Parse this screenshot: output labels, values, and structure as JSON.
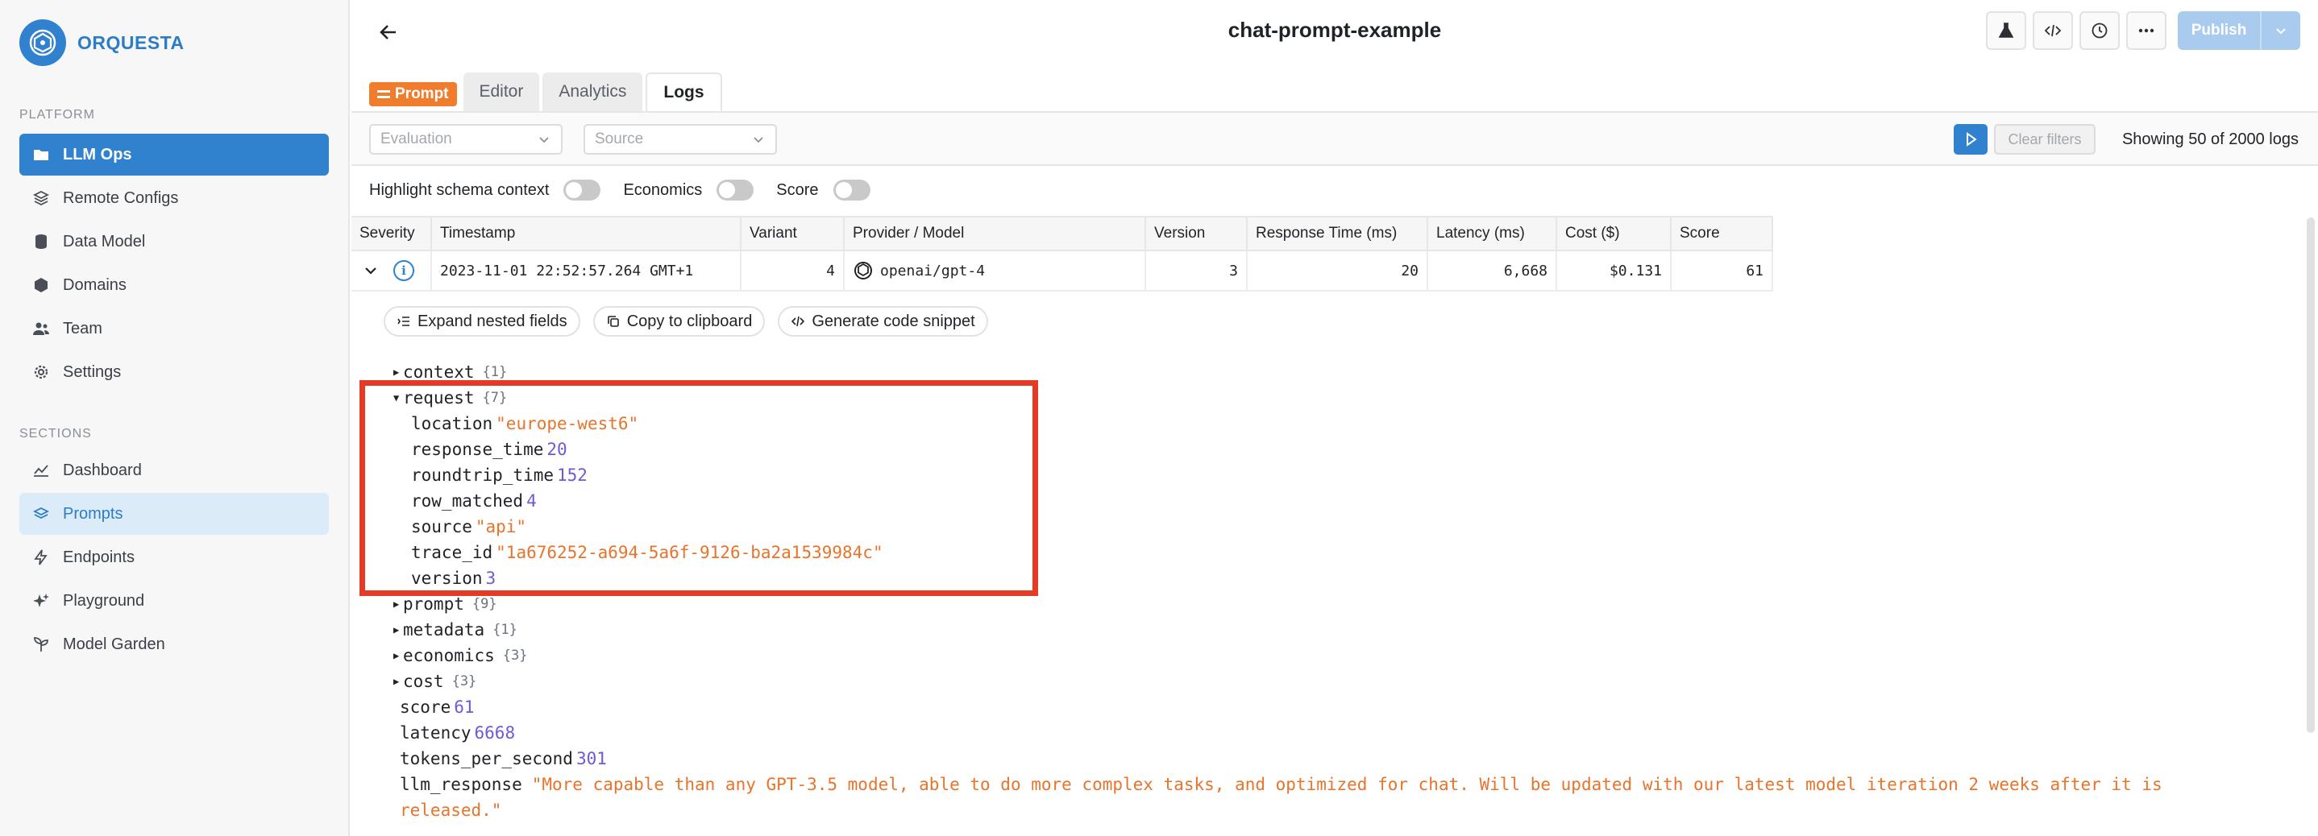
{
  "brand": {
    "name": "ORQUESTA"
  },
  "sidebar": {
    "platform_label": "PLATFORM",
    "platform_items": [
      {
        "label": "LLM Ops",
        "icon": "folder-icon"
      },
      {
        "label": "Remote Configs",
        "icon": "layers-icon"
      },
      {
        "label": "Data Model",
        "icon": "database-icon"
      },
      {
        "label": "Domains",
        "icon": "cube-icon"
      },
      {
        "label": "Team",
        "icon": "users-icon"
      },
      {
        "label": "Settings",
        "icon": "gear-icon"
      }
    ],
    "sections_label": "SECTIONS",
    "section_items": [
      {
        "label": "Dashboard",
        "icon": "chart-line-icon"
      },
      {
        "label": "Prompts",
        "icon": "stack-icon"
      },
      {
        "label": "Endpoints",
        "icon": "bolt-icon"
      },
      {
        "label": "Playground",
        "icon": "sparkles-icon"
      },
      {
        "label": "Model Garden",
        "icon": "plant-icon"
      }
    ]
  },
  "header": {
    "title": "chat-prompt-example",
    "publish_label": "Publish"
  },
  "tabs": {
    "badge": "Prompt",
    "items": [
      "Editor",
      "Analytics",
      "Logs"
    ],
    "active": "Logs"
  },
  "filters": {
    "evaluation_placeholder": "Evaluation",
    "source_placeholder": "Source",
    "clear_label": "Clear filters",
    "showing": "Showing 50 of 2000 logs"
  },
  "toggles": {
    "highlight_schema": "Highlight schema context",
    "economics": "Economics",
    "score": "Score"
  },
  "table": {
    "headers": {
      "severity": "Severity",
      "timestamp": "Timestamp",
      "variant": "Variant",
      "provider": "Provider / Model",
      "version": "Version",
      "response_time": "Response Time (ms)",
      "latency": "Latency (ms)",
      "cost": "Cost ($)",
      "score": "Score"
    },
    "row": {
      "timestamp": "2023-11-01 22:52:57.264 GMT+1",
      "variant": "4",
      "provider": "openai/gpt-4",
      "version": "3",
      "response_time": "20",
      "latency": "6,668",
      "cost": "$0.131",
      "score": "61"
    }
  },
  "actions": {
    "expand": "Expand nested fields",
    "copy": "Copy to clipboard",
    "generate": "Generate code snippet"
  },
  "json": {
    "context": {
      "key": "context",
      "count": "{1}"
    },
    "request": {
      "key": "request",
      "count": "{7}",
      "fields": {
        "location": {
          "key": "location",
          "value": "\"europe-west6\""
        },
        "response_time": {
          "key": "response_time",
          "value": "20"
        },
        "roundtrip_time": {
          "key": "roundtrip_time",
          "value": "152"
        },
        "row_matched": {
          "key": "row_matched",
          "value": "4"
        },
        "source": {
          "key": "source",
          "value": "\"api\""
        },
        "trace_id": {
          "key": "trace_id",
          "value": "\"1a676252-a694-5a6f-9126-ba2a1539984c\""
        },
        "version": {
          "key": "version",
          "value": "3"
        }
      }
    },
    "prompt": {
      "key": "prompt",
      "count": "{9}"
    },
    "metadata": {
      "key": "metadata",
      "count": "{1}"
    },
    "economics": {
      "key": "economics",
      "count": "{3}"
    },
    "cost": {
      "key": "cost",
      "count": "{3}"
    },
    "score": {
      "key": "score",
      "value": "61"
    },
    "latency": {
      "key": "latency",
      "value": "6668"
    },
    "tokens_per_second": {
      "key": "tokens_per_second",
      "value": "301"
    },
    "llm_response": {
      "key": "llm_response",
      "value_line1": "\"More capable than any GPT-3.5 model, able to do more complex tasks, and optimized for chat. Will be updated with our latest model iteration 2 weeks after it is",
      "value_line2": "released.\""
    }
  },
  "colors": {
    "accent": "#3182ce",
    "prompt_badge": "#f07c2d",
    "json_string": "#e8742b",
    "json_number": "#6b5bd6",
    "highlight_box": "#e53a26"
  }
}
